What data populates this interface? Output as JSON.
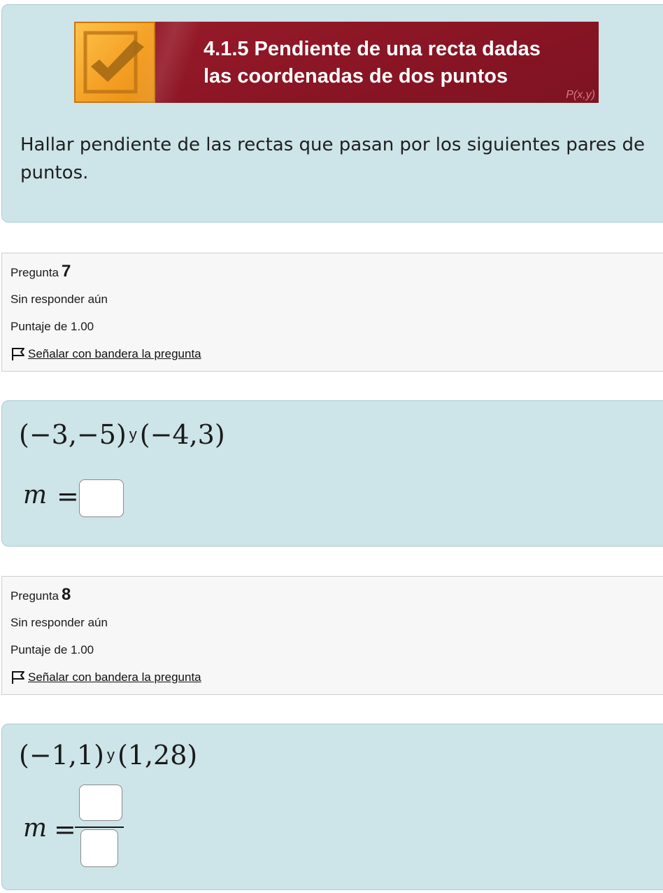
{
  "intro": {
    "banner_title_line1": "4.1.5 Pendiente de una recta dadas",
    "banner_title_line2": "las coordenadas de dos puntos",
    "banner_subscript": "P(x,y)",
    "instruction": "Hallar pendiente de las rectas que pasan por los siguientes pares de puntos.",
    "badge_icon": "checkmark-icon",
    "colors": {
      "banner": "#8a1524",
      "badge": "#f4a126",
      "panel": "#cde4e8"
    }
  },
  "questions": [
    {
      "label": "Pregunta",
      "number": "7",
      "state": "Sin responder aún",
      "grade": "Puntaje de 1.00",
      "flag_label": "Señalar con bandera la pregunta",
      "flag_icon": "flag-icon",
      "point_a": "(−3,−5)",
      "connector": "y",
      "point_b": "(−4,3)",
      "answer_variable": "m",
      "equals": "=",
      "answer_format": "single"
    },
    {
      "label": "Pregunta",
      "number": "8",
      "state": "Sin responder aún",
      "grade": "Puntaje de 1.00",
      "flag_label": "Señalar con bandera la pregunta",
      "flag_icon": "flag-icon",
      "point_a": "(−1,1)",
      "connector": "y",
      "point_b": "(1,28)",
      "answer_variable": "m",
      "equals": "=",
      "answer_format": "fraction"
    }
  ]
}
